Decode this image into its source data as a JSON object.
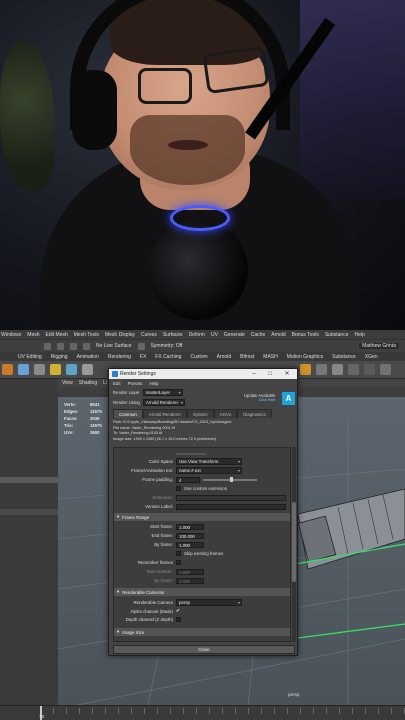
{
  "maya": {
    "menubar": [
      "Windows",
      "Mesh",
      "Edit Mesh",
      "Mesh Tools",
      "Mesh Display",
      "Curves",
      "Surfaces",
      "Deform",
      "UV",
      "Generate",
      "Cache",
      "Arnold",
      "Bonus Tools",
      "Substance",
      "Help"
    ],
    "status": {
      "live_surface": "No Live Surface",
      "symmetry": "Symmetry: Off",
      "user": "Matthew Grinta"
    },
    "shelf_tabs": [
      "UV Editing",
      "Rigging",
      "Animation",
      "Rendering",
      "FX",
      "FX Caching",
      "Custom",
      "Arnold",
      "Bifrost",
      "MASH",
      "Motion Graphics",
      "Substance",
      "XGen"
    ],
    "viewport_menu": [
      "View",
      "Shading",
      "Li"
    ],
    "stats": [
      {
        "label": "Verts:",
        "value": "8541"
      },
      {
        "label": "Edges:",
        "value": "11575"
      },
      {
        "label": "Faces:",
        "value": "3036"
      },
      {
        "label": "Tris:",
        "value": "11975"
      },
      {
        "label": "UVs:",
        "value": "3600"
      }
    ],
    "camera_label": "persp",
    "current_frame": "70"
  },
  "dialog": {
    "title": "Render Settings",
    "menu": [
      "Edit",
      "Presets",
      "Help"
    ],
    "render_layer_label": "Render Layer",
    "render_layer_value": "masterLayer",
    "render_using_label": "Render Using",
    "render_using_value": "Arnold Renderer",
    "update_title": "Update Available",
    "update_sub": "Click Here",
    "arnold_logo": "A",
    "tabs": [
      "Common",
      "Arnold Renderer",
      "System",
      "AOVs",
      "Diagnostics"
    ],
    "path_lines": [
      "Path: G:/Crypto_Visionary/Branding/3D Assets/CV_2024_/vpx/images/",
      "File name: Vader_Rendering.0001.tif",
      "To: Vader_Rendering.0100.tif",
      "Image size: 1920 x 1080 (26.7 x 15.0 inches 72.0 pixels/inch)"
    ],
    "fields": {
      "color_space_label": "Color Space",
      "color_space_value": "Use View Transform",
      "frame_anim_label": "Frame/Animation ext:",
      "frame_anim_value": "name.#.ext",
      "frame_padding_label": "Frame padding:",
      "frame_padding_value": "4",
      "custom_ext_label": "Use custom extension",
      "extension_label": "Extension:",
      "version_label": "Version Label:"
    },
    "frame_range": {
      "header": "Frame Range",
      "start_label": "Start frame:",
      "start_value": "1.000",
      "end_label": "End frame:",
      "end_value": "100.000",
      "by_label": "By frame:",
      "by_value": "1.000",
      "skip_label": "Skip existing frames",
      "renumber_label": "Renumber frames",
      "start_number_label": "Start number:",
      "start_number_value": "1.000",
      "by_frame2_label": "By frame:",
      "by_frame2_value": "1.000"
    },
    "renderable_cameras": {
      "header": "Renderable Cameras",
      "camera_label": "Renderable Camera",
      "camera_value": "persp",
      "alpha_label": "Alpha channel (Mask)",
      "depth_label": "Depth channel (Z depth)"
    },
    "image_size_header": "Image Size",
    "close_label": "Close"
  }
}
